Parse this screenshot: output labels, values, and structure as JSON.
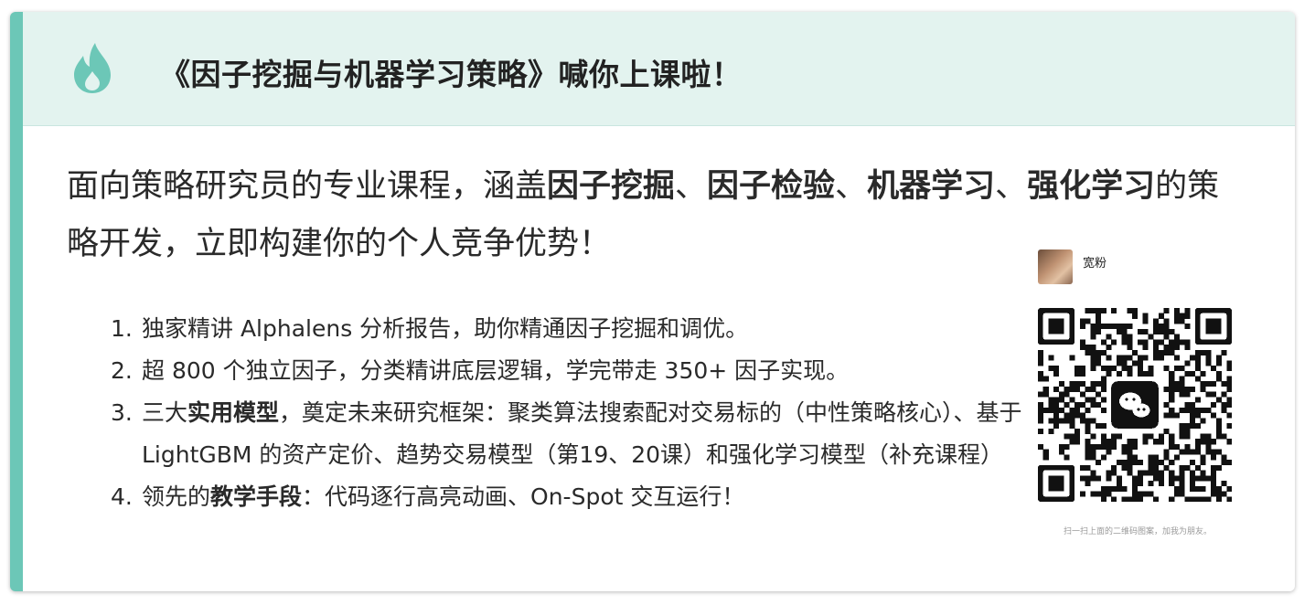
{
  "header": {
    "title": "《因子挖掘与机器学习策略》喊你上课啦！",
    "icon": "flame-icon",
    "accent_color": "#6cc7b7",
    "background_color": "#e3f3ef"
  },
  "intro": {
    "part1": "面向策略研究员的专业课程，涵盖",
    "bold1": "因子挖掘",
    "sep1": "、",
    "bold2": "因子检验",
    "sep2": "、",
    "bold3": "机器学习",
    "sep3": "、",
    "bold4": "强化学习",
    "part2": "的策略开发，立即构建你的个人竞争优势！"
  },
  "features": [
    {
      "num": "1.",
      "text": "独家精讲 Alphalens 分析报告，助你精通因子挖掘和调优。"
    },
    {
      "num": "2.",
      "text": "超 800 个独立因子，分类精讲底层逻辑，学完带走 350+ 因子实现。"
    },
    {
      "num": "3.",
      "pre": "三大",
      "bold": "实用模型",
      "post": "，奠定未来研究框架：聚类算法搜索配对交易标的（中性策略核心）、基于 LightGBM 的资产定价、趋势交易模型（第19、20课）和强化学习模型（补充课程）"
    },
    {
      "num": "4.",
      "pre": "领先的",
      "bold": "教学手段",
      "post": "：代码逐行高亮动画、On-Spot 交互运行！"
    }
  ],
  "qr": {
    "name": "宽粉",
    "caption": "扫一扫上面的二维码图案，加我为朋友。",
    "center_icon": "wechat-icon"
  }
}
